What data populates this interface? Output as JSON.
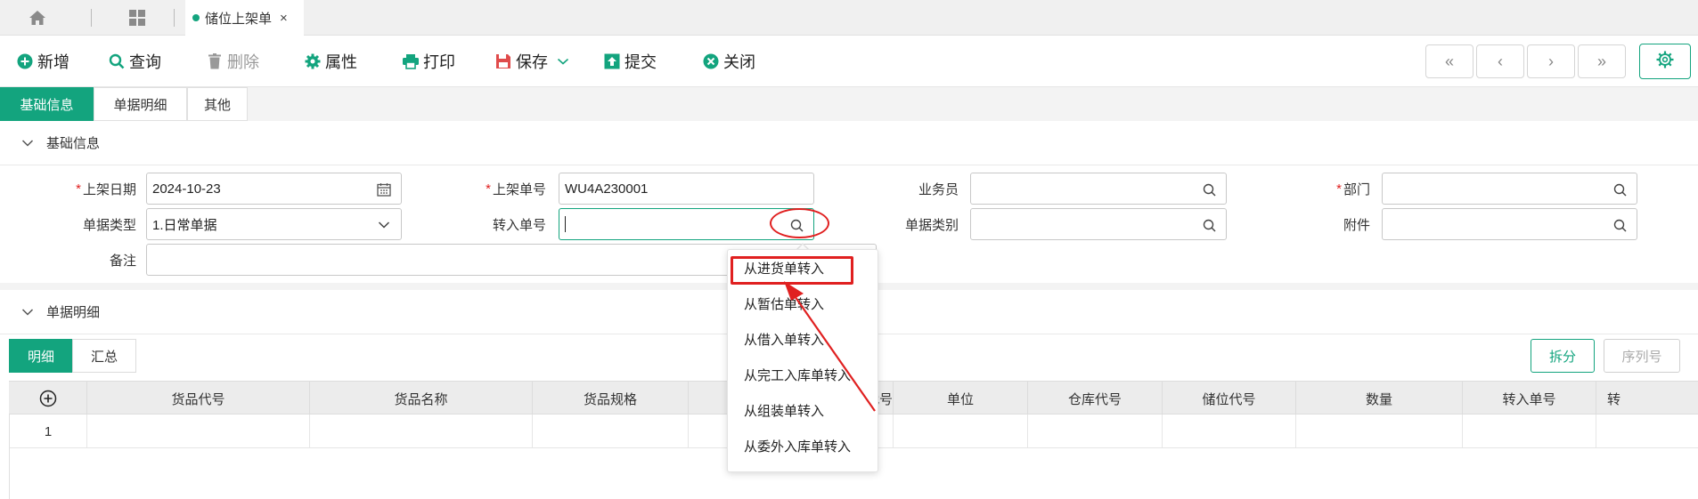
{
  "tabs": {
    "home_icon": "home-icon",
    "apps_icon": "grid-icon",
    "active_tab": {
      "label": "储位上架单",
      "close": "×"
    }
  },
  "toolbar": {
    "new": "新增",
    "query": "查询",
    "delete": "删除",
    "properties": "属性",
    "print": "打印",
    "save": "保存",
    "submit": "提交",
    "close": "关闭",
    "nav": {
      "first": "«",
      "prev": "‹",
      "next": "›",
      "last": "»"
    }
  },
  "subtabs": [
    "基础信息",
    "单据明细",
    "其他"
  ],
  "basic_section": {
    "title": "基础信息",
    "fields": {
      "shelf_date": {
        "label": "上架日期",
        "value": "2024-10-23",
        "required": true
      },
      "shelf_no": {
        "label": "上架单号",
        "value": "WU4A230001",
        "required": true
      },
      "salesman": {
        "label": "业务员",
        "value": ""
      },
      "department": {
        "label": "部门",
        "value": "",
        "required": true
      },
      "doc_type": {
        "label": "单据类型",
        "value": "1.日常单据"
      },
      "transfer_no": {
        "label": "转入单号",
        "value": ""
      },
      "doc_category": {
        "label": "单据类别",
        "value": ""
      },
      "attachment": {
        "label": "附件",
        "value": ""
      },
      "remark": {
        "label": "备注",
        "value": ""
      }
    },
    "required_mark": "*"
  },
  "detail_section": {
    "title": "单据明细",
    "tabs": [
      "明细",
      "汇总"
    ],
    "buttons": {
      "split": "拆分",
      "serial": "序列号"
    },
    "columns": [
      "货品代号",
      "货品名称",
      "货品规格",
      "",
      "批次代号",
      "单位",
      "仓库代号",
      "储位代号",
      "数量",
      "转入单号",
      "转"
    ],
    "rows": [
      {
        "index": "1"
      }
    ]
  },
  "dropdown": {
    "items": [
      "从进货单转入",
      "从暂估单转入",
      "从借入单转入",
      "从完工入库单转入",
      "从组装单转入",
      "从委外入库单转入"
    ],
    "highlighted": "从进货单转入"
  },
  "colors": {
    "accent": "#13a47e",
    "annotation": "#e02020"
  }
}
